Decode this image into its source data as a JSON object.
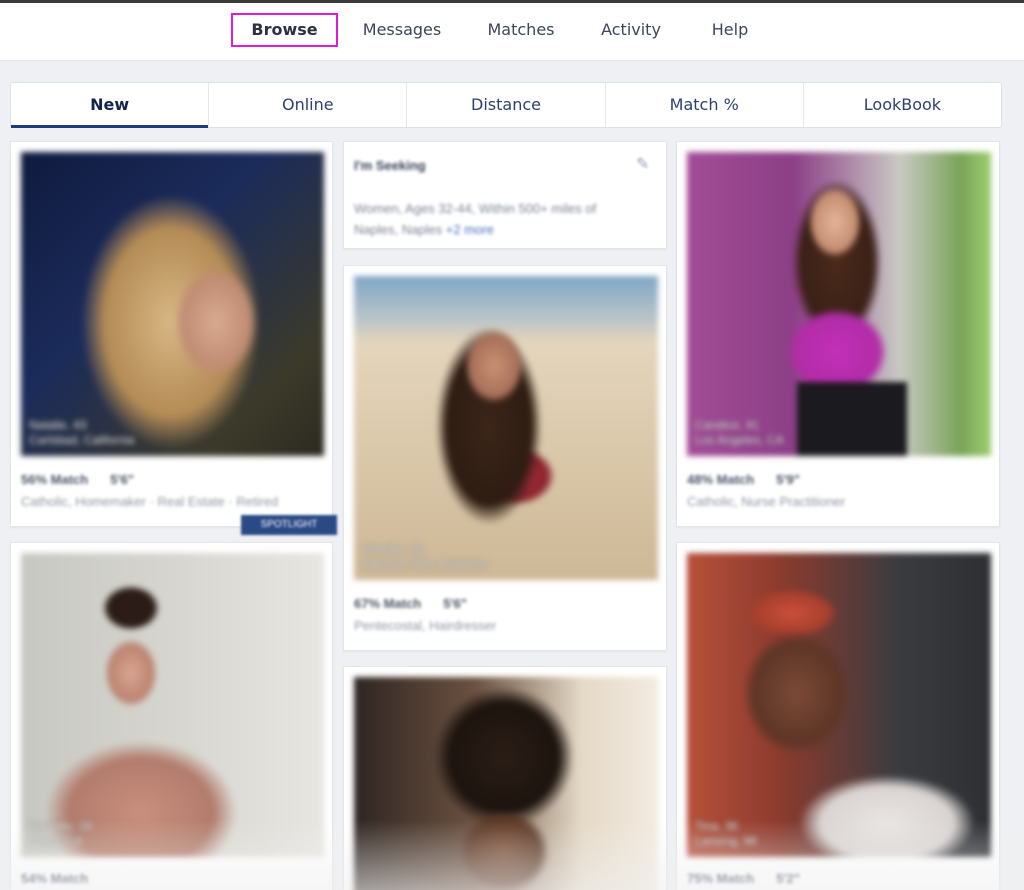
{
  "nav": {
    "items": [
      {
        "label": "Browse",
        "active": true
      },
      {
        "label": "Messages",
        "active": false
      },
      {
        "label": "Matches",
        "active": false
      },
      {
        "label": "Activity",
        "active": false
      },
      {
        "label": "Help",
        "active": false
      }
    ]
  },
  "tabs": [
    {
      "label": "New",
      "active": true
    },
    {
      "label": "Online",
      "active": false
    },
    {
      "label": "Distance",
      "active": false
    },
    {
      "label": "Match %",
      "active": false
    },
    {
      "label": "LookBook",
      "active": false
    }
  ],
  "seeking": {
    "title": "I'm Seeking",
    "description": "Women, Ages 32-44, Within 500+ miles of Naples, Naples",
    "more": "+2 more"
  },
  "profiles": [
    {
      "name_age": "Natalie, 43",
      "location": "Carlsbad, California",
      "match": "56% Match",
      "height": "5'6\"",
      "details": "Catholic, Homemaker · Real Estate · Retired",
      "badge": "SPOTLIGHT"
    },
    {
      "name_age": "Candice, 41",
      "location": "Los Angeles, CA",
      "match": "48% Match",
      "height": "5'9\"",
      "details": "Catholic, Nurse Practitioner"
    },
    {
      "name_age": "Priscilla, 35",
      "location": "Harrison Hills, Anaheim",
      "match": "67% Match",
      "height": "5'6\"",
      "details": "Pentecostal, Hairdresser"
    },
    {
      "name_age": "Danielle, 38",
      "location": "Chico, CA",
      "match": "54% Match",
      "height": "",
      "details": ""
    },
    {
      "name_age": "Tina, 36",
      "location": "Lansing, MI",
      "match": "75% Match",
      "height": "5'2\"",
      "details": ""
    }
  ],
  "colors": {
    "accent": "#1f3c78",
    "highlight_box": "#e01ad6",
    "background": "#eef0f3"
  }
}
